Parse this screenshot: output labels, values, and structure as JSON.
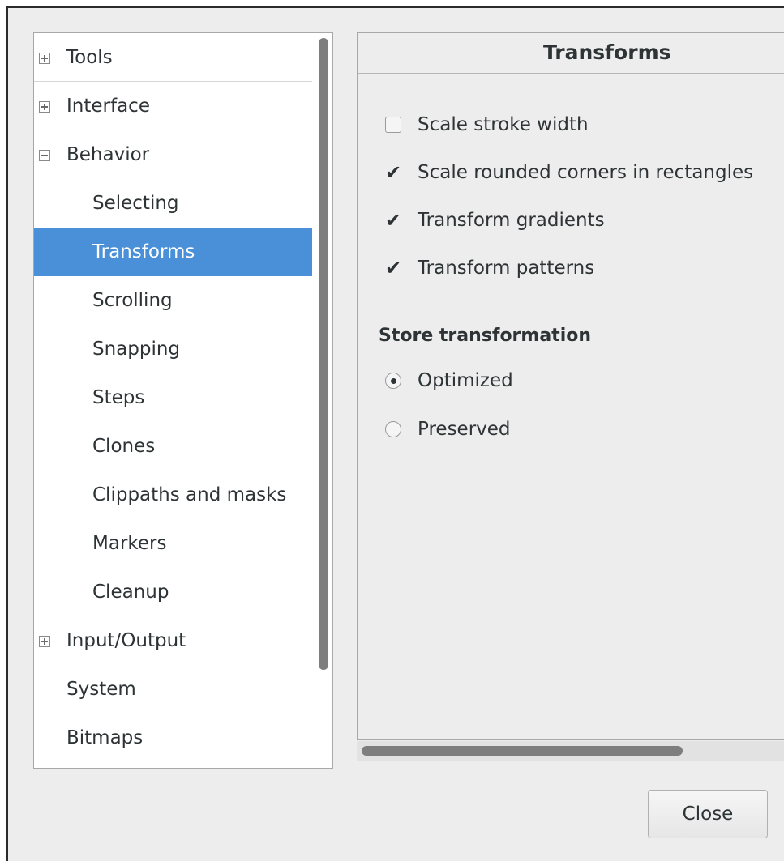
{
  "tree": {
    "items": [
      {
        "label": "Tools",
        "expander": "plus"
      },
      {
        "label": "Interface",
        "expander": "plus"
      },
      {
        "label": "Behavior",
        "expander": "minus"
      },
      {
        "label": "Selecting"
      },
      {
        "label": "Transforms",
        "selected": true
      },
      {
        "label": "Scrolling"
      },
      {
        "label": "Snapping"
      },
      {
        "label": "Steps"
      },
      {
        "label": "Clones"
      },
      {
        "label": "Clippaths and masks"
      },
      {
        "label": "Markers"
      },
      {
        "label": "Cleanup"
      },
      {
        "label": "Input/Output",
        "expander": "plus"
      },
      {
        "label": "System"
      },
      {
        "label": "Bitmaps"
      }
    ]
  },
  "panel": {
    "title": "Transforms",
    "checkboxes": [
      {
        "label": "Scale stroke width",
        "checked": false
      },
      {
        "label": "Scale rounded corners in rectangles",
        "checked": true
      },
      {
        "label": "Transform gradients",
        "checked": true
      },
      {
        "label": "Transform patterns",
        "checked": true
      }
    ],
    "store_heading": "Store transformation",
    "radios": [
      {
        "label": "Optimized",
        "selected": true
      },
      {
        "label": "Preserved",
        "selected": false
      }
    ]
  },
  "buttons": {
    "close": "Close"
  },
  "colors": {
    "selection": "#4a90d9",
    "dialog_bg": "#ededed"
  }
}
